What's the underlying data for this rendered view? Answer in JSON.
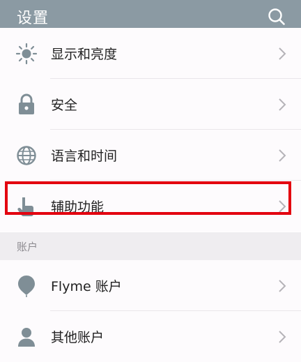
{
  "appbar": {
    "title": "设置",
    "search_icon": "search-icon"
  },
  "rows": [
    {
      "label": "显示和亮度",
      "icon": "brightness-icon"
    },
    {
      "label": "安全",
      "icon": "lock-icon"
    },
    {
      "label": "语言和时间",
      "icon": "globe-icon"
    },
    {
      "label": "辅助功能",
      "icon": "accessibility-hand-icon"
    }
  ],
  "section": {
    "title": "账户"
  },
  "account_rows": [
    {
      "label": "Flyme 账户",
      "icon": "flyme-balloon-icon"
    },
    {
      "label": "其他账户",
      "icon": "user-icon"
    }
  ],
  "colors": {
    "appbar_bg": "#8b9aa3",
    "highlight_border": "#e3000f",
    "icon_gray": "#7f8e96"
  }
}
